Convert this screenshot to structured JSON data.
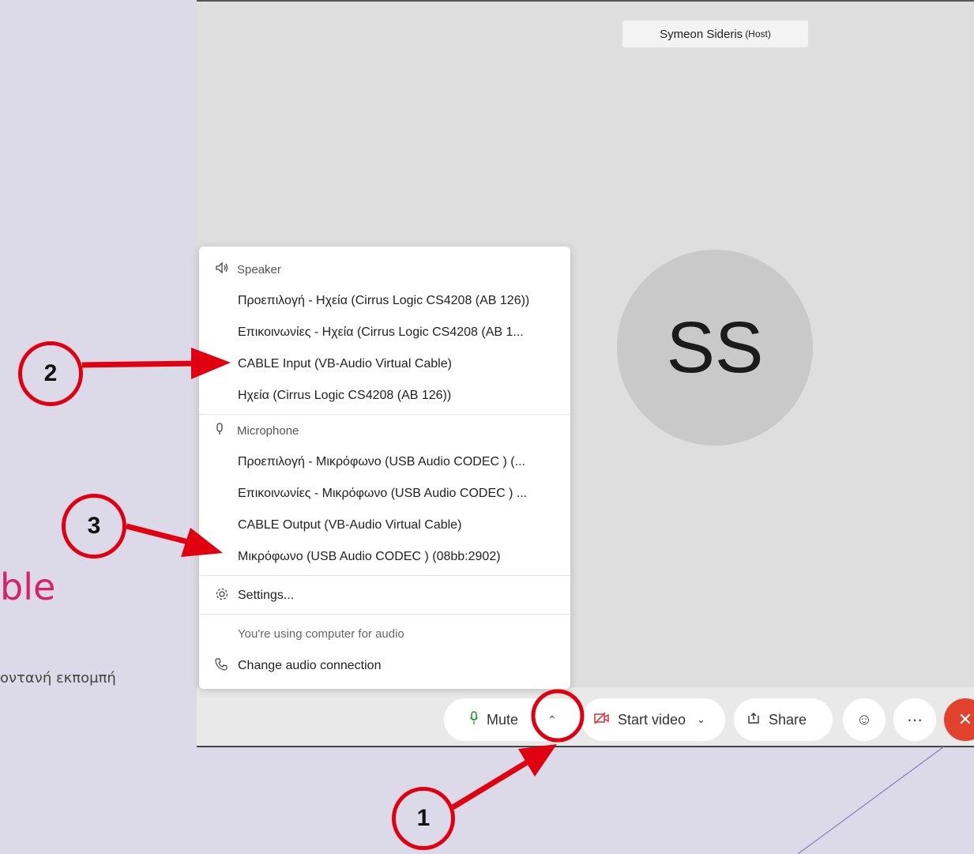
{
  "background_slide": {
    "title_fragment": "ble",
    "subtitle_fragment": "οντανή εκπομπή"
  },
  "meeting": {
    "host_name": "Symeon Sideris",
    "host_role": "(Host)",
    "avatar_initials": "SS"
  },
  "audio_menu": {
    "speaker_header": "Speaker",
    "speaker_items": [
      "Προεπιλογή - Ηχεία (Cirrus Logic CS4208 (AB 126))",
      "Επικοινωνίες - Ηχεία (Cirrus Logic CS4208 (AB 1...",
      "CABLE Input (VB-Audio Virtual Cable)",
      "Ηχεία (Cirrus Logic CS4208 (AB 126))"
    ],
    "microphone_header": "Microphone",
    "microphone_items": [
      "Προεπιλογή - Μικρόφωνο (USB Audio CODEC ) (...",
      "Επικοινωνίες - Μικρόφωνο (USB Audio CODEC ) ...",
      "CABLE Output (VB-Audio Virtual Cable)",
      "Μικρόφωνο (USB Audio CODEC ) (08bb:2902)"
    ],
    "settings_label": "Settings...",
    "audio_note": "You're using computer for audio",
    "change_audio_label": "Change audio connection"
  },
  "toolbar": {
    "mute_label": "Mute",
    "start_video_label": "Start video",
    "share_label": "Share"
  },
  "annotations": {
    "badge_1": "1",
    "badge_2": "2",
    "badge_3": "3",
    "color": "#e0000f"
  },
  "icons": [
    "speaker-icon",
    "microphone-icon",
    "gear-icon",
    "phone-icon",
    "chevron-up-icon",
    "chevron-down-icon",
    "camera-off-icon",
    "share-icon",
    "emoji-icon",
    "more-icon",
    "close-icon"
  ]
}
